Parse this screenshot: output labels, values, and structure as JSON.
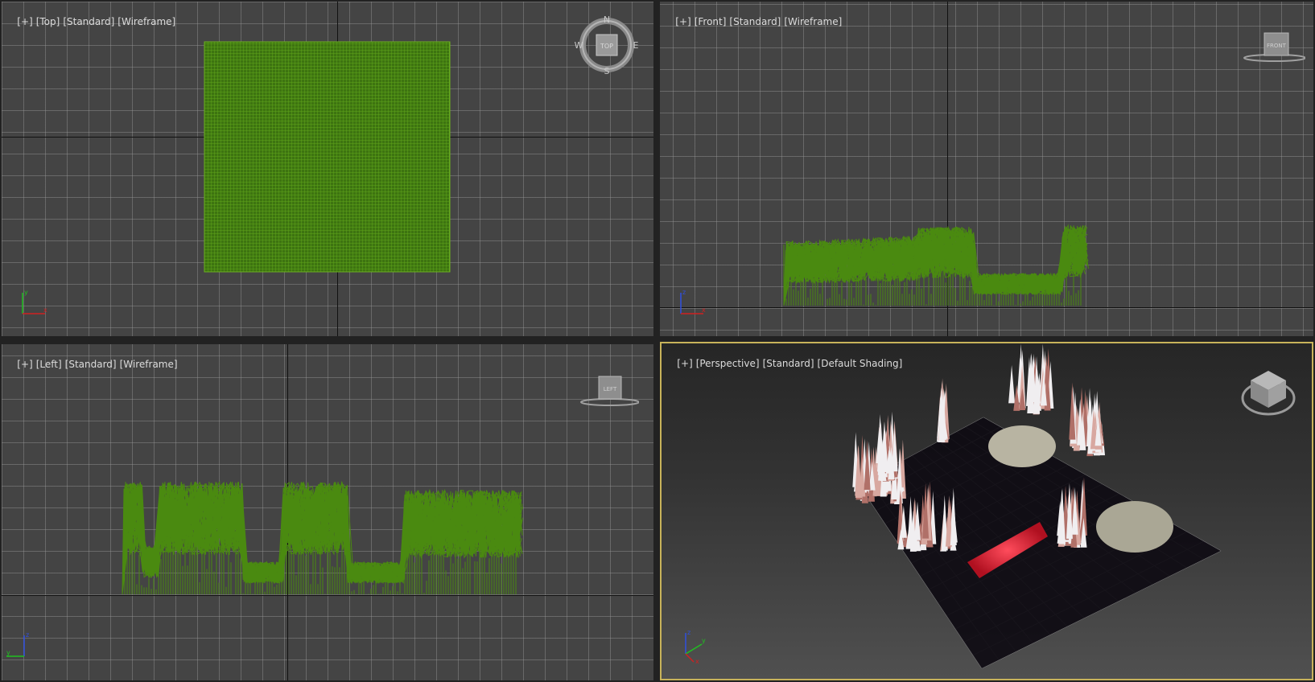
{
  "viewports": {
    "top": {
      "labels": [
        "[+]",
        "[Top]",
        "[Standard]",
        "[Wireframe]"
      ],
      "viewcube": "TOP",
      "compass": {
        "n": "N",
        "s": "S",
        "e": "E",
        "w": "W"
      },
      "axes": {
        "a": "y",
        "b": "x"
      }
    },
    "front": {
      "labels": [
        "[+]",
        "[Front]",
        "[Standard]",
        "[Wireframe]"
      ],
      "viewcube": "FRONT",
      "axes": {
        "a": "z",
        "b": "x"
      }
    },
    "left": {
      "labels": [
        "[+]",
        "[Left]",
        "[Standard]",
        "[Wireframe]"
      ],
      "viewcube": "LEFT",
      "axes": {
        "a": "z",
        "b": "y"
      }
    },
    "perspective": {
      "labels": [
        "[+]",
        "[Perspective]",
        "[Standard]",
        "[Default Shading]"
      ],
      "axes": {
        "a": "z",
        "b": "y",
        "c": "x"
      }
    }
  },
  "colors": {
    "viewport_bg": "#444444",
    "grid": "#969696",
    "wireframe": "#4a8a10",
    "active_border": "#c8b35a",
    "axis_x": "#d02020",
    "axis_y": "#20c020",
    "axis_z": "#3050e0"
  }
}
